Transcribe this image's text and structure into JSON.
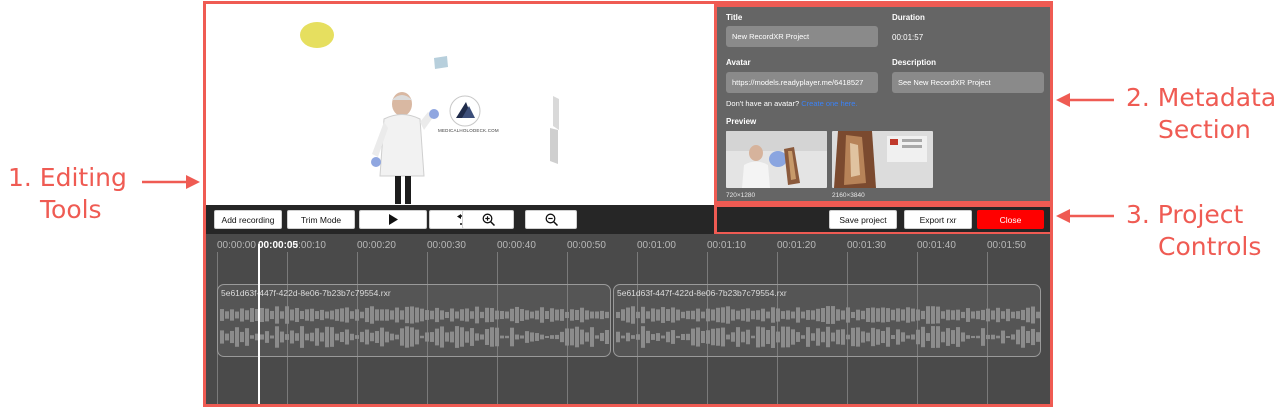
{
  "annotations": {
    "editing_tools": [
      "1. Editing",
      "Tools"
    ],
    "metadata_section": [
      "2. Metadata",
      "Section"
    ],
    "project_controls": [
      "3. Project",
      "Controls"
    ]
  },
  "viewport": {
    "logo_text": "MEDICALHOLODECK.COM"
  },
  "metadata": {
    "title_label": "Title",
    "title_value": "New RecordXR Project",
    "duration_label": "Duration",
    "duration_value": "00:01:57",
    "avatar_label": "Avatar",
    "avatar_value": "https://models.readyplayer.me/6418527",
    "description_label": "Description",
    "description_value": "See New RecordXR Project",
    "avatar_hint": "Don't have an avatar?",
    "avatar_link": "Create one here.",
    "preview_label": "Preview",
    "preview_1_caption": "720×1280",
    "preview_2_caption": "2160×3840"
  },
  "toolbar": {
    "add_recording": "Add recording",
    "trim_mode": "Trim Mode",
    "play_icon": "play-icon",
    "undo_icon": "undo-icon",
    "zoom_in_icon": "zoom-in-icon",
    "zoom_out_icon": "zoom-out-icon"
  },
  "project_controls": {
    "save": "Save project",
    "export": "Export rxr",
    "close": "Close",
    "close_color": "#ff0000"
  },
  "timeline": {
    "ticks": [
      "00:00:00",
      "00:00:10",
      "00:00:20",
      "00:00:30",
      "00:00:40",
      "00:00:50",
      "00:01:00",
      "00:01:10",
      "00:01:20",
      "00:01:30",
      "00:01:40",
      "00:01:50"
    ],
    "playhead_time": "00:00:05",
    "clips": [
      {
        "name": "5e61d63f-447f-422d-8e06-7b23b7c79554.rxr"
      },
      {
        "name": "5e61d63f-447f-422d-8e06-7b23b7c79554.rxr"
      }
    ]
  },
  "colors": {
    "accent": "#ef5b53",
    "panel": "#656565",
    "toolbar": "#262626",
    "timeline": "#4a4a4a"
  }
}
